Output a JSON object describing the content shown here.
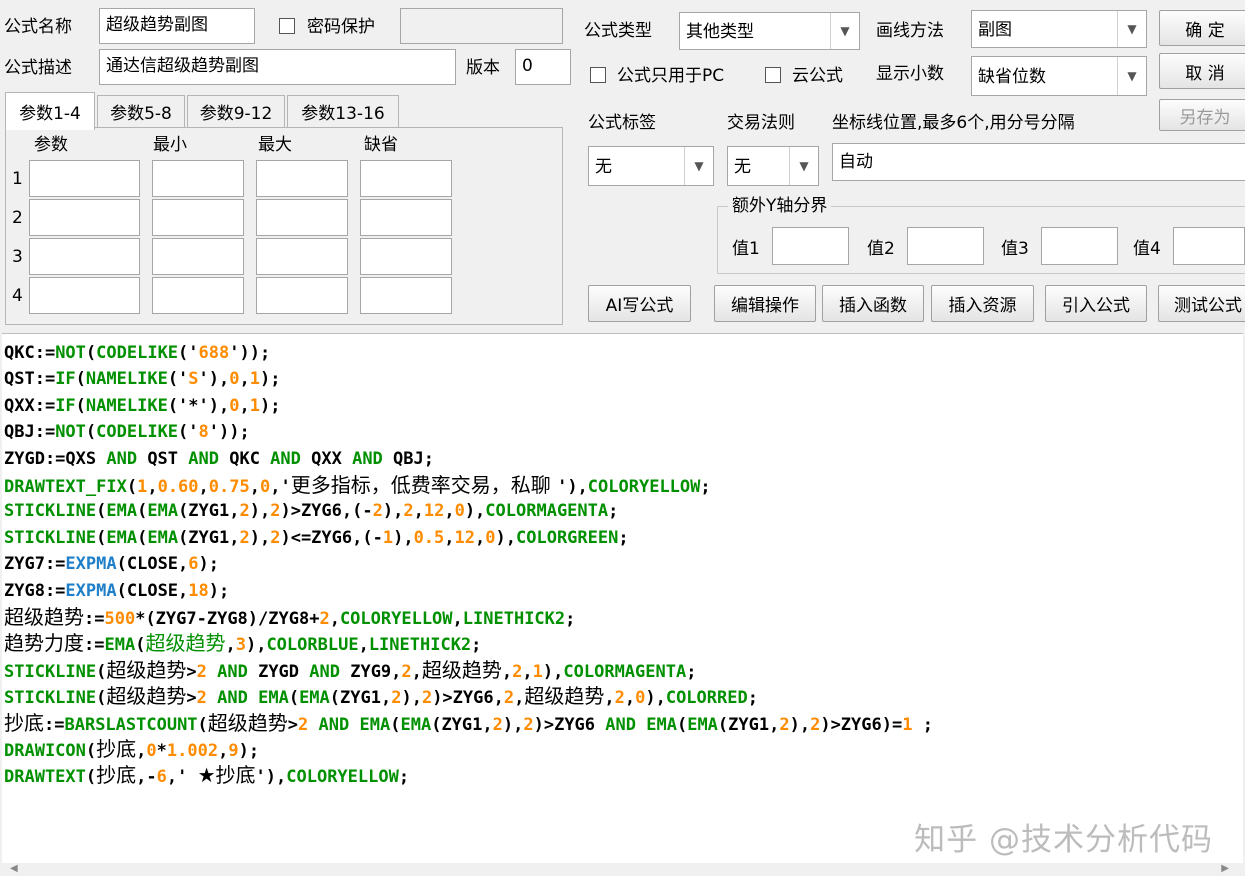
{
  "top": {
    "name_label": "公式名称",
    "name_value": "超级趋势副图",
    "password_label": "密码保护",
    "desc_label": "公式描述",
    "desc_value": "通达信超级趋势副图",
    "version_label": "版本",
    "version_value": "0",
    "type_label": "公式类型",
    "type_value": "其他类型",
    "draw_label": "画线方法",
    "draw_value": "副图",
    "pc_only_label": "公式只用于PC",
    "cloud_label": "云公式",
    "decimals_label": "显示小数",
    "decimals_value": "缺省位数",
    "ok_button": "确  定",
    "cancel_button": "取  消",
    "save_as_button": "另存为"
  },
  "params": {
    "tabs": [
      "参数1-4",
      "参数5-8",
      "参数9-12",
      "参数13-16"
    ],
    "headers": [
      "参数",
      "最小",
      "最大",
      "缺省"
    ],
    "rows": [
      "1",
      "2",
      "3",
      "4"
    ]
  },
  "right": {
    "tag_label": "公式标签",
    "tag_value": "无",
    "rule_label": "交易法则",
    "rule_value": "无",
    "axis_label": "坐标线位置,最多6个,用分号分隔",
    "axis_value": "自动",
    "yaxis_group": "额外Y轴分界",
    "val_labels": [
      "值1",
      "值2",
      "值3",
      "值4"
    ]
  },
  "toolbar": {
    "ai": "AI写公式",
    "edit": "编辑操作",
    "insert_func": "插入函数",
    "insert_res": "插入资源",
    "import": "引入公式",
    "test": "测试公式"
  },
  "code_lines": [
    [
      [
        "QKC:=",
        "bl"
      ],
      [
        "NOT",
        "gr"
      ],
      [
        "(",
        "bl"
      ],
      [
        "CODELIKE",
        "gr"
      ],
      [
        "('",
        "bl"
      ],
      [
        "688",
        "or"
      ],
      [
        "'));",
        "bl"
      ]
    ],
    [
      [
        "QST:=",
        "bl"
      ],
      [
        "IF",
        "gr"
      ],
      [
        "(",
        "bl"
      ],
      [
        "NAMELIKE",
        "gr"
      ],
      [
        "('",
        "bl"
      ],
      [
        "S",
        "or"
      ],
      [
        "'),",
        "bl"
      ],
      [
        "0",
        "or"
      ],
      [
        ",",
        "bl"
      ],
      [
        "1",
        "or"
      ],
      [
        ");",
        "bl"
      ]
    ],
    [
      [
        "QXX:=",
        "bl"
      ],
      [
        "IF",
        "gr"
      ],
      [
        "(",
        "bl"
      ],
      [
        "NAMELIKE",
        "gr"
      ],
      [
        "('",
        "bl"
      ],
      [
        "*",
        "bl"
      ],
      [
        "'),",
        "bl"
      ],
      [
        "0",
        "or"
      ],
      [
        ",",
        "bl"
      ],
      [
        "1",
        "or"
      ],
      [
        ");",
        "bl"
      ]
    ],
    [
      [
        "QBJ:=",
        "bl"
      ],
      [
        "NOT",
        "gr"
      ],
      [
        "(",
        "bl"
      ],
      [
        "CODELIKE",
        "gr"
      ],
      [
        "('",
        "bl"
      ],
      [
        "8",
        "or"
      ],
      [
        "'));",
        "bl"
      ]
    ],
    [
      [
        "ZYGD:=QXS ",
        "bl"
      ],
      [
        "AND",
        "gr"
      ],
      [
        " QST ",
        "bl"
      ],
      [
        "AND",
        "gr"
      ],
      [
        " QKC ",
        "bl"
      ],
      [
        "AND",
        "gr"
      ],
      [
        " QXX ",
        "bl"
      ],
      [
        "AND",
        "gr"
      ],
      [
        " QBJ;",
        "bl"
      ]
    ],
    [
      [
        "DRAWTEXT_FIX",
        "gr"
      ],
      [
        "(",
        "bl"
      ],
      [
        "1",
        "or"
      ],
      [
        ",",
        "bl"
      ],
      [
        "0.60",
        "or"
      ],
      [
        ",",
        "bl"
      ],
      [
        "0.75",
        "or"
      ],
      [
        ",",
        "bl"
      ],
      [
        "0",
        "or"
      ],
      [
        ",'",
        "bl"
      ],
      [
        "更多指标，低费率交易，私聊 ",
        "bl cn"
      ],
      [
        "'),",
        "bl"
      ],
      [
        "COLORYELLOW",
        "gr"
      ],
      [
        ";",
        "bl"
      ]
    ],
    [
      [
        "STICKLINE",
        "gr"
      ],
      [
        "(",
        "bl"
      ],
      [
        "EMA",
        "gr"
      ],
      [
        "(",
        "bl"
      ],
      [
        "EMA",
        "gr"
      ],
      [
        "(ZYG1,",
        "bl"
      ],
      [
        "2",
        "or"
      ],
      [
        "),",
        "bl"
      ],
      [
        "2",
        "or"
      ],
      [
        ")>ZYG6,(-",
        "bl"
      ],
      [
        "2",
        "or"
      ],
      [
        "),",
        "bl"
      ],
      [
        "2",
        "or"
      ],
      [
        ",",
        "bl"
      ],
      [
        "12",
        "or"
      ],
      [
        ",",
        "bl"
      ],
      [
        "0",
        "or"
      ],
      [
        "),",
        "bl"
      ],
      [
        "COLORMAGENTA",
        "gr"
      ],
      [
        ";",
        "bl"
      ]
    ],
    [
      [
        "STICKLINE",
        "gr"
      ],
      [
        "(",
        "bl"
      ],
      [
        "EMA",
        "gr"
      ],
      [
        "(",
        "bl"
      ],
      [
        "EMA",
        "gr"
      ],
      [
        "(ZYG1,",
        "bl"
      ],
      [
        "2",
        "or"
      ],
      [
        "),",
        "bl"
      ],
      [
        "2",
        "or"
      ],
      [
        ")<=ZYG6,(-",
        "bl"
      ],
      [
        "1",
        "or"
      ],
      [
        "),",
        "bl"
      ],
      [
        "0.5",
        "or"
      ],
      [
        ",",
        "bl"
      ],
      [
        "12",
        "or"
      ],
      [
        ",",
        "bl"
      ],
      [
        "0",
        "or"
      ],
      [
        "),",
        "bl"
      ],
      [
        "COLORGREEN",
        "gr"
      ],
      [
        ";",
        "bl"
      ]
    ],
    [
      [
        "ZYG7:=",
        "bl"
      ],
      [
        "EXPMA",
        "bu"
      ],
      [
        "(",
        "bl"
      ],
      [
        "CLOSE",
        "bl"
      ],
      [
        ",",
        "bl"
      ],
      [
        "6",
        "or"
      ],
      [
        ");",
        "bl"
      ]
    ],
    [
      [
        "ZYG8:=",
        "bl"
      ],
      [
        "EXPMA",
        "bu"
      ],
      [
        "(",
        "bl"
      ],
      [
        "CLOSE",
        "bl"
      ],
      [
        ",",
        "bl"
      ],
      [
        "18",
        "or"
      ],
      [
        ");",
        "bl"
      ]
    ],
    [
      [
        "超级趋势",
        "bl cn"
      ],
      [
        ":=",
        "bl"
      ],
      [
        "500",
        "or"
      ],
      [
        "*(ZYG7-ZYG8)/ZYG8+",
        "bl"
      ],
      [
        "2",
        "or"
      ],
      [
        ",",
        "bl"
      ],
      [
        "COLORYELLOW",
        "gr"
      ],
      [
        ",",
        "bl"
      ],
      [
        "LINETHICK2",
        "gr"
      ],
      [
        ";",
        "bl"
      ]
    ],
    [
      [
        "趋势力度",
        "bl cn"
      ],
      [
        ":=",
        "bl"
      ],
      [
        "EMA",
        "gr"
      ],
      [
        "(",
        "bl"
      ],
      [
        "超级趋势",
        "gr cn"
      ],
      [
        ",",
        "bl"
      ],
      [
        "3",
        "or"
      ],
      [
        "),",
        "bl"
      ],
      [
        "COLORBLUE",
        "gr"
      ],
      [
        ",",
        "bl"
      ],
      [
        "LINETHICK2",
        "gr"
      ],
      [
        ";",
        "bl"
      ]
    ],
    [
      [
        "STICKLINE",
        "gr"
      ],
      [
        "(",
        "bl"
      ],
      [
        "超级趋势",
        "bl cn"
      ],
      [
        ">",
        "bl"
      ],
      [
        "2",
        "or"
      ],
      [
        " ",
        "bl"
      ],
      [
        "AND",
        "gr"
      ],
      [
        " ZYGD ",
        "bl"
      ],
      [
        "AND",
        "gr"
      ],
      [
        " ZYG9,",
        "bl"
      ],
      [
        "2",
        "or"
      ],
      [
        ",",
        "bl"
      ],
      [
        "超级趋势",
        "bl cn"
      ],
      [
        ",",
        "bl"
      ],
      [
        "2",
        "or"
      ],
      [
        ",",
        "bl"
      ],
      [
        "1",
        "or"
      ],
      [
        "),",
        "bl"
      ],
      [
        "COLORMAGENTA",
        "gr"
      ],
      [
        ";",
        "bl"
      ]
    ],
    [
      [
        "STICKLINE",
        "gr"
      ],
      [
        "(",
        "bl"
      ],
      [
        "超级趋势",
        "bl cn"
      ],
      [
        ">",
        "bl"
      ],
      [
        "2",
        "or"
      ],
      [
        " ",
        "bl"
      ],
      [
        "AND",
        "gr"
      ],
      [
        " ",
        "bl"
      ],
      [
        "EMA",
        "gr"
      ],
      [
        "(",
        "bl"
      ],
      [
        "EMA",
        "gr"
      ],
      [
        "(ZYG1,",
        "bl"
      ],
      [
        "2",
        "or"
      ],
      [
        "),",
        "bl"
      ],
      [
        "2",
        "or"
      ],
      [
        ")>ZYG6,",
        "bl"
      ],
      [
        "2",
        "or"
      ],
      [
        ",",
        "bl"
      ],
      [
        "超级趋势",
        "bl cn"
      ],
      [
        ",",
        "bl"
      ],
      [
        "2",
        "or"
      ],
      [
        ",",
        "bl"
      ],
      [
        "0",
        "or"
      ],
      [
        "),",
        "bl"
      ],
      [
        "COLORRED",
        "gr"
      ],
      [
        ";",
        "bl"
      ]
    ],
    [
      [
        "抄底",
        "bl cn"
      ],
      [
        ":=",
        "bl"
      ],
      [
        "BARSLASTCOUNT",
        "gr"
      ],
      [
        "(",
        "bl"
      ],
      [
        "超级趋势",
        "bl cn"
      ],
      [
        ">",
        "bl"
      ],
      [
        "2",
        "or"
      ],
      [
        " ",
        "bl"
      ],
      [
        "AND",
        "gr"
      ],
      [
        " ",
        "bl"
      ],
      [
        "EMA",
        "gr"
      ],
      [
        "(",
        "bl"
      ],
      [
        "EMA",
        "gr"
      ],
      [
        "(ZYG1,",
        "bl"
      ],
      [
        "2",
        "or"
      ],
      [
        "),",
        "bl"
      ],
      [
        "2",
        "or"
      ],
      [
        ")>ZYG6 ",
        "bl"
      ],
      [
        "AND",
        "gr"
      ],
      [
        " ",
        "bl"
      ],
      [
        "EMA",
        "gr"
      ],
      [
        "(",
        "bl"
      ],
      [
        "EMA",
        "gr"
      ],
      [
        "(ZYG1,",
        "bl"
      ],
      [
        "2",
        "or"
      ],
      [
        "),",
        "bl"
      ],
      [
        "2",
        "or"
      ],
      [
        ")>ZYG6)=",
        "bl"
      ],
      [
        "1",
        "or"
      ],
      [
        " ;",
        "bl"
      ]
    ],
    [
      [
        "DRAWICON",
        "gr"
      ],
      [
        "(",
        "bl"
      ],
      [
        "抄底",
        "bl cn"
      ],
      [
        ",",
        "bl"
      ],
      [
        "0",
        "or"
      ],
      [
        "*",
        "bl"
      ],
      [
        "1.002",
        "or"
      ],
      [
        ",",
        "bl"
      ],
      [
        "9",
        "or"
      ],
      [
        ");",
        "bl"
      ]
    ],
    [
      [
        "DRAWTEXT",
        "gr"
      ],
      [
        "(",
        "bl"
      ],
      [
        "抄底",
        "bl cn"
      ],
      [
        ",-",
        "bl"
      ],
      [
        "6",
        "or"
      ],
      [
        ",' ",
        "bl"
      ],
      [
        "★抄底",
        "bl cn"
      ],
      [
        "'),",
        "bl"
      ],
      [
        "COLORYELLOW",
        "gr"
      ],
      [
        ";",
        "bl"
      ]
    ]
  ],
  "watermark": "知乎 @技术分析代码",
  "colors": {
    "keyword": "#009000",
    "number": "#ff8c00",
    "function_blue": "#1e7fc8",
    "text": "#000000",
    "window_bg": "#f0f0f0"
  },
  "icons": {
    "dropdown": "chevron-down-icon",
    "scroll_left": "scroll-left-icon",
    "scroll_right": "scroll-right-icon"
  }
}
